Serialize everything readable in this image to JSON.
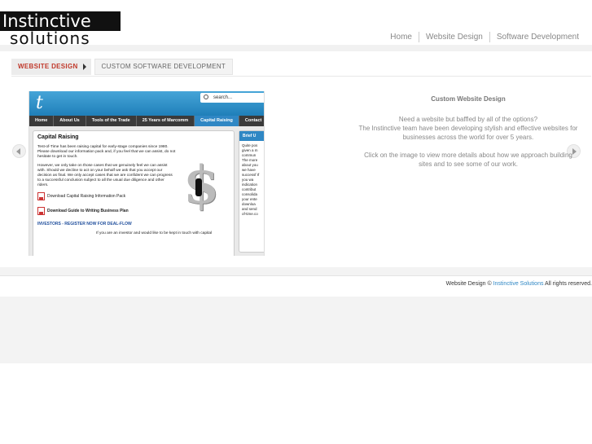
{
  "brand": {
    "line1": "Instinctive",
    "line2": "solutions"
  },
  "topnav": [
    {
      "label": "Home"
    },
    {
      "label": "Website Design"
    },
    {
      "label": "Software Development"
    }
  ],
  "tabs": [
    {
      "label": "WEBSITE DESIGN",
      "active": true
    },
    {
      "label": "CUSTOM SOFTWARE DEVELOPMENT",
      "active": false
    }
  ],
  "slide": {
    "title": "Custom Website Design",
    "line1": "Need a website but baffled by all of the options?",
    "line2": "The Instinctive team have been developing stylish and effective websites for businesses across the world for over 5 years.",
    "line3": "Click on the image to view more details about how we approach building sites and to see some of our work."
  },
  "preview": {
    "logo": "t",
    "search_placeholder": "search...",
    "nav": [
      "Home",
      "About Us",
      "Tools of the Trade",
      "25 Years of Marcomm",
      "Capital Raising",
      "Contact"
    ],
    "active_nav": "Capital Raising",
    "heading": "Capital Raising",
    "para1": "Test-of-Time has been raising capital for early-stage companies since 1980. Please download our information pack and, if you feel that we can assist, do not hesitate to get in touch.",
    "para2": "However, we only take on those cases that we genuinely feel we can assist with. Should we decline to act on your behalf we ask that you accept our decision as final. We only accept cases that we are confident we can progress to a successful conclusion subject to all the usual due diligence and other riders.",
    "download1": "Download Capital Raising Information Pack",
    "download2": "Download Guide to Writing Business Plan",
    "investors": "INVESTORS - REGISTER NOW FOR DEAL-FLOW",
    "foot": "If you are an investor and would like to be kept in touch with capital",
    "side_heading": "Brief U",
    "side_text": "Quite pos given a m commun The more about you we have successf If you wa indication contribut consolida your ente downloa and send of-time.co",
    "dollar": "$"
  },
  "footer": {
    "prefix": "Website Design ©",
    "link": "Instinctive Solutions",
    "suffix": "All rights reserved."
  }
}
